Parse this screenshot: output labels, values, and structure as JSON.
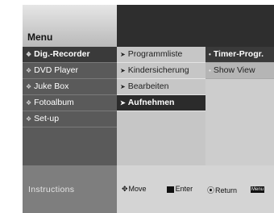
{
  "menu": {
    "title": "Menu"
  },
  "main_menu": [
    {
      "label": "Dig.-Recorder",
      "selected": true
    },
    {
      "label": "DVD Player"
    },
    {
      "label": "Juke Box"
    },
    {
      "label": "Fotoalbum"
    },
    {
      "label": "Set-up"
    }
  ],
  "sub_menu": [
    {
      "label": "Programmliste"
    },
    {
      "label": "Kindersicherung"
    },
    {
      "label": "Bearbeiten"
    },
    {
      "label": "Aufnehmen",
      "selected": true
    }
  ],
  "third_menu": [
    {
      "label": "Timer-Progr.",
      "selected": true
    },
    {
      "label": "Show View"
    }
  ],
  "footer": {
    "instructions": "Instructions",
    "move": "Move",
    "enter": "Enter",
    "return": "Return",
    "menu_key": "Menu"
  },
  "icons": {
    "main_bullet": "diamond-bullet-icon",
    "sub_bullet": "arrow-bullet-icon",
    "third_bullet": "dot-bullet-icon"
  }
}
